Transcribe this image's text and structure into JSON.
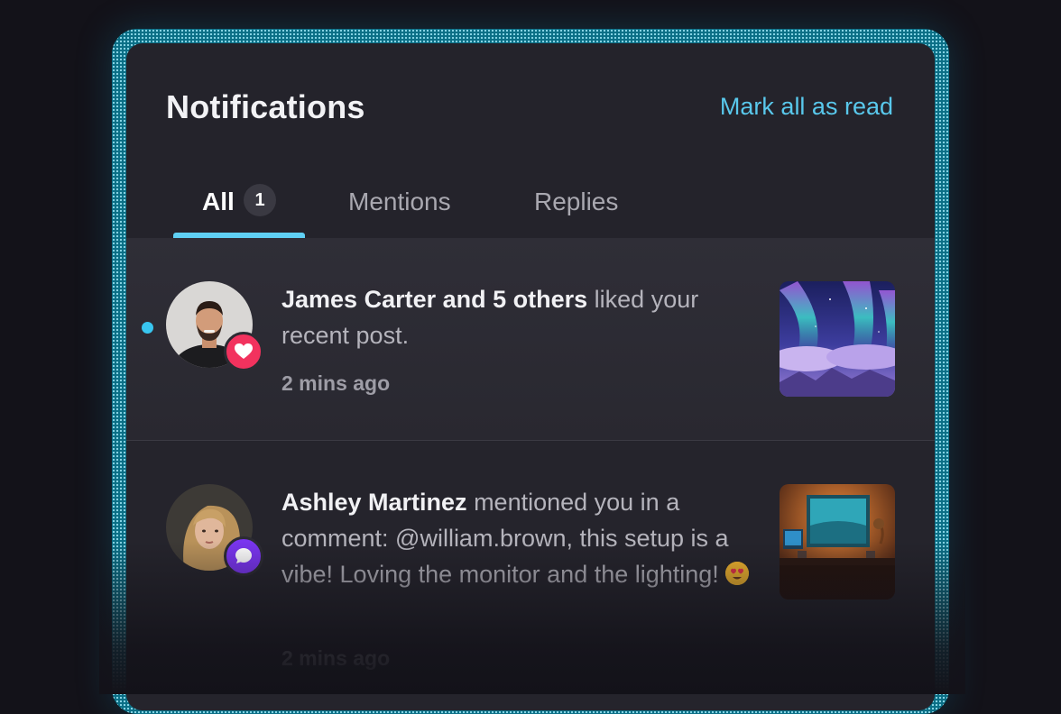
{
  "header": {
    "title": "Notifications",
    "mark_all_label": "Mark all as read"
  },
  "tabs": [
    {
      "label": "All",
      "badge": "1",
      "active": true
    },
    {
      "label": "Mentions",
      "active": false
    },
    {
      "label": "Replies",
      "active": false
    }
  ],
  "notifications": [
    {
      "actor": "James Carter and 5 others",
      "text": " liked your recent post.",
      "time": "2 mins ago",
      "unread": true,
      "reaction_icon": "heart-icon",
      "reaction_color": "#f2325e"
    },
    {
      "actor": "Ashley Martinez",
      "text": " mentioned you in a comment: @william.brown, this setup is a vibe! Loving the monitor and the lighting! ",
      "emoji": "heart-eyes-emoji",
      "time": "2 mins ago",
      "unread": false,
      "reaction_icon": "comment-icon",
      "reaction_color": "#7a35f0"
    }
  ],
  "colors": {
    "accent": "#5fd0f4",
    "link": "#59c8ec",
    "unread_dot": "#38c6f0",
    "panel": "#24232b",
    "background": "#131219"
  }
}
